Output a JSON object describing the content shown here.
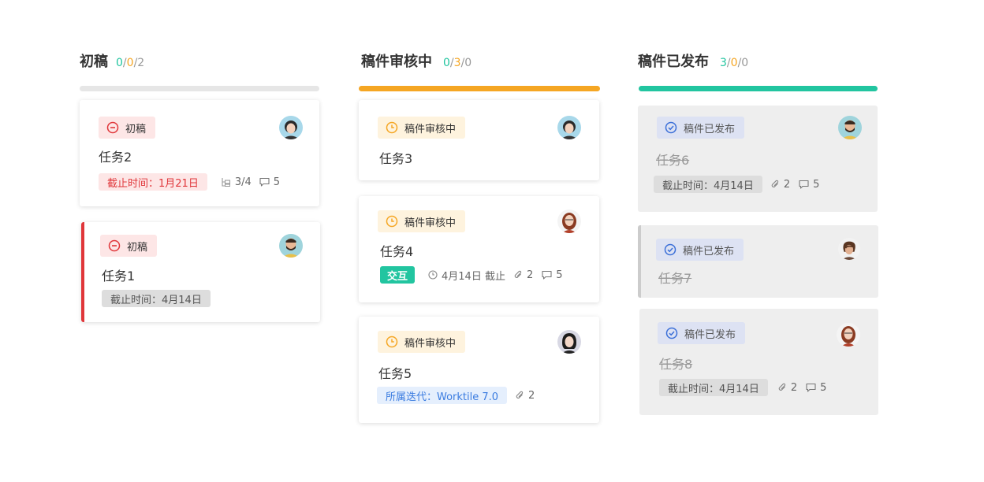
{
  "colors": {
    "draft_bar": "#e6e6e6",
    "review_bar": "#f5a623",
    "published_bar": "#22c5a0",
    "draft_accent": "#e0363a",
    "published_accent": "#cccccc",
    "done_count": "#22c5a0",
    "progress_count": "#f5a623"
  },
  "columns": [
    {
      "title": "初稿",
      "counts": {
        "done": "0",
        "progress": "0",
        "total": "2",
        "sep": "/"
      },
      "cards": [
        {
          "status": "初稿",
          "status_icon": "minus-circle-icon",
          "avatar": "avatar-woman-1",
          "title": "任务2",
          "deadline": "截止时间：1月21日",
          "subtask_icon": "subtask-icon",
          "subtasks": "3/4",
          "comment_icon": "comment-icon",
          "comments": "5"
        },
        {
          "status": "初稿",
          "status_icon": "minus-circle-icon",
          "avatar": "avatar-man-1",
          "title": "任务1",
          "deadline": "截止时间：4月14日"
        }
      ]
    },
    {
      "title": "稿件审核中",
      "counts": {
        "done": "0",
        "progress": "3",
        "total": "0",
        "sep": "/"
      },
      "cards": [
        {
          "status": "稿件审核中",
          "status_icon": "clock-icon",
          "avatar": "avatar-woman-1",
          "title": "任务3"
        },
        {
          "status": "稿件审核中",
          "status_icon": "clock-icon",
          "avatar": "avatar-woman-2",
          "title": "任务4",
          "label": "交互",
          "clock_icon": "clock-icon",
          "due": "4月14日 截止",
          "attachment_icon": "paperclip-icon",
          "attachments": "2",
          "comment_icon": "comment-icon",
          "comments": "5"
        },
        {
          "status": "稿件审核中",
          "status_icon": "clock-icon",
          "avatar": "avatar-woman-3",
          "title": "任务5",
          "iteration": "所属迭代：Worktile 7.0",
          "attachment_icon": "paperclip-icon",
          "attachments": "2"
        }
      ]
    },
    {
      "title": "稿件已发布",
      "counts": {
        "done": "3",
        "progress": "0",
        "total": "0",
        "sep": "/"
      },
      "cards": [
        {
          "status": "稿件已发布",
          "status_icon": "check-circle-icon",
          "avatar": "avatar-man-1",
          "title": "任务6",
          "deadline": "截止时间：4月14日",
          "attachment_icon": "paperclip-icon",
          "attachments": "2",
          "comment_icon": "comment-icon",
          "comments": "5"
        },
        {
          "status": "稿件已发布",
          "status_icon": "check-circle-icon",
          "avatar": "avatar-man-2",
          "title": "任务7"
        },
        {
          "status": "稿件已发布",
          "status_icon": "check-circle-icon",
          "avatar": "avatar-woman-2",
          "title": "任务8",
          "deadline": "截止时间：4月14日",
          "attachment_icon": "paperclip-icon",
          "attachments": "2",
          "comment_icon": "comment-icon",
          "comments": "5"
        }
      ]
    }
  ]
}
